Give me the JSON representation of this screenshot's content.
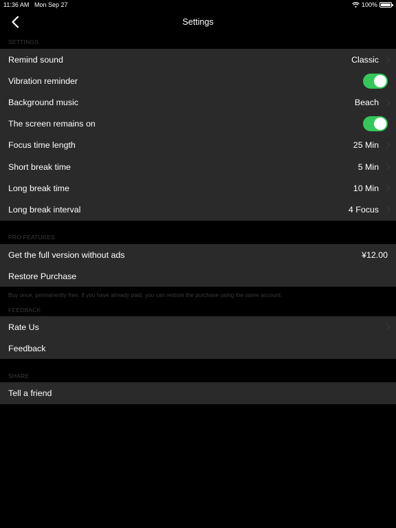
{
  "status_bar": {
    "time": "11:36 AM",
    "date": "Mon Sep 27",
    "battery": "100%",
    "wifi_icon": "wifi-icon",
    "battery_icon": "battery-full-icon"
  },
  "nav": {
    "title": "Settings",
    "back_icon": "chevron-left-icon"
  },
  "colors": {
    "background": "#000000",
    "group_background": "#2a2a2a",
    "toggle_on": "#34c759",
    "section_header": "#3a3a3a"
  },
  "sections": {
    "settings": {
      "header": "SETTINGS",
      "rows": [
        {
          "label": "Remind sound",
          "value": "Classic",
          "type": "disclosure"
        },
        {
          "label": "Vibration reminder",
          "type": "toggle",
          "on": true
        },
        {
          "label": "Background music",
          "value": "Beach",
          "type": "disclosure"
        },
        {
          "label": "The screen remains on",
          "type": "toggle",
          "on": true
        },
        {
          "label": "Focus time length",
          "value": "25 Min",
          "type": "disclosure"
        },
        {
          "label": "Short break time",
          "value": "5 Min",
          "type": "disclosure"
        },
        {
          "label": "Long break time",
          "value": "10 Min",
          "type": "disclosure"
        },
        {
          "label": "Long break interval",
          "value": "4 Focus",
          "type": "disclosure"
        }
      ]
    },
    "pro": {
      "header": "PRO FEATURES",
      "rows": [
        {
          "label": "Get the full version without ads",
          "value": "¥12.00",
          "type": "value"
        },
        {
          "label": "Restore Purchase",
          "type": "plain"
        }
      ],
      "footer": "Buy once, permanently free. If you have already paid, you can restore the purchase using the same account."
    },
    "feedback": {
      "header": "FEEDBACK",
      "rows": [
        {
          "label": "Rate Us",
          "type": "disclosure"
        },
        {
          "label": "Feedback",
          "type": "plain"
        }
      ]
    },
    "share": {
      "header": "SHARE",
      "rows": [
        {
          "label": "Tell a friend",
          "type": "plain"
        }
      ]
    }
  }
}
